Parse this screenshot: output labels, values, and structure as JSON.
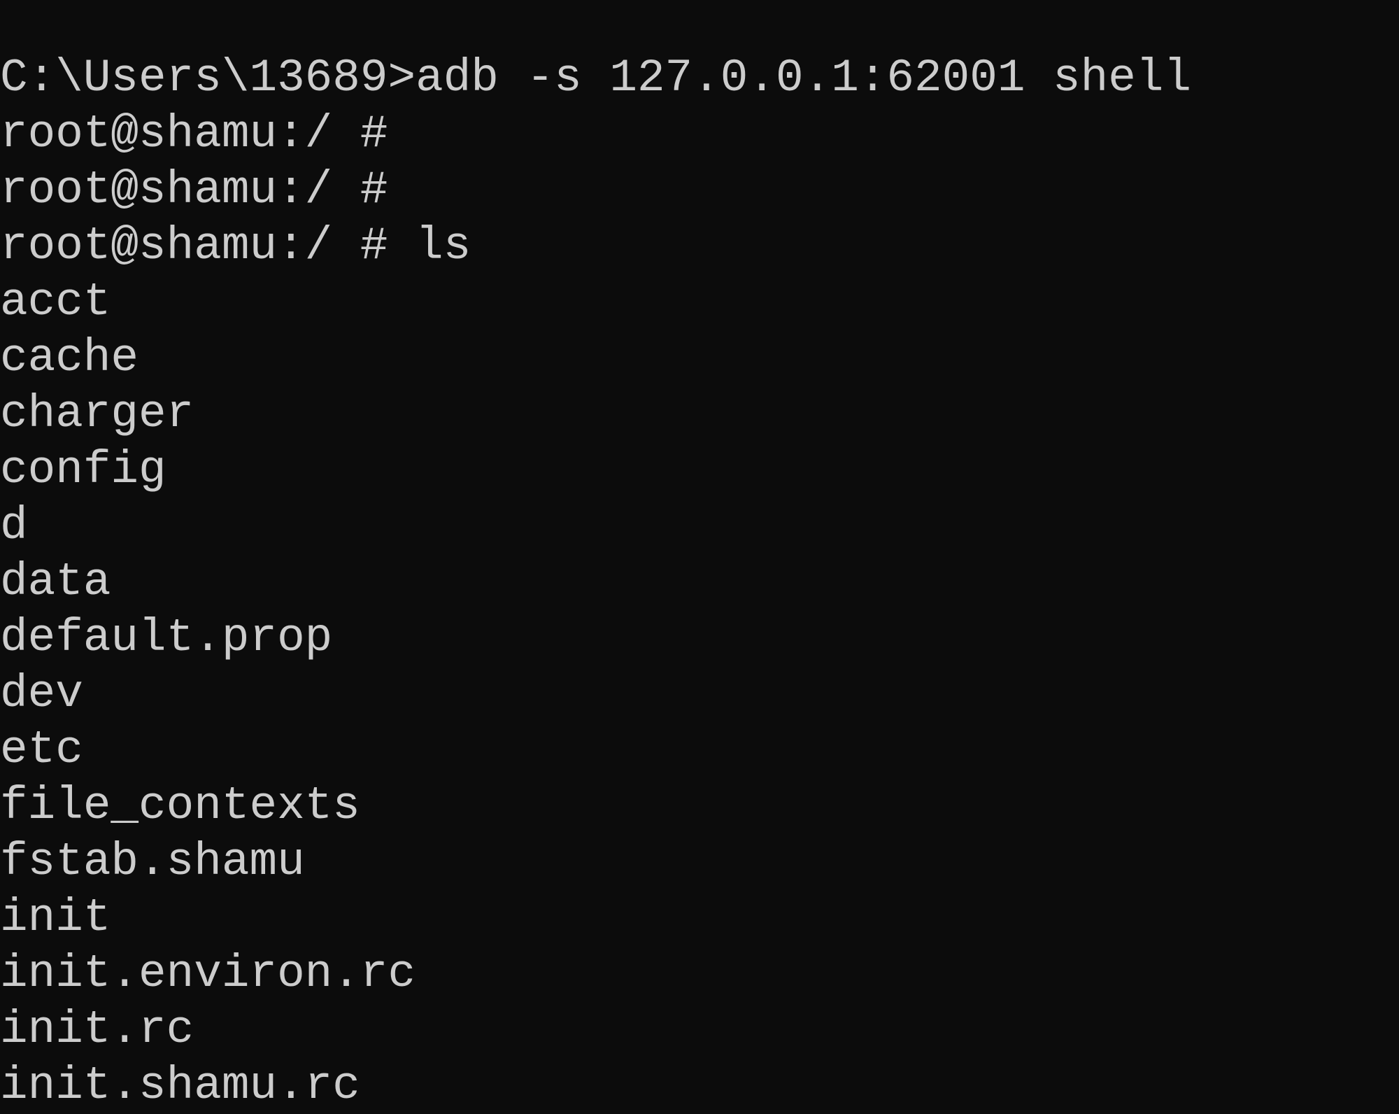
{
  "terminal": {
    "colors": {
      "background": "#0c0c0c",
      "foreground": "#cccccc"
    },
    "lines": [
      "C:\\Users\\13689>adb -s 127.0.0.1:62001 shell",
      "root@shamu:/ #",
      "root@shamu:/ #",
      "root@shamu:/ # ls",
      "acct",
      "cache",
      "charger",
      "config",
      "d",
      "data",
      "default.prop",
      "dev",
      "etc",
      "file_contexts",
      "fstab.shamu",
      "init",
      "init.environ.rc",
      "init.rc",
      "init.shamu.rc"
    ]
  }
}
